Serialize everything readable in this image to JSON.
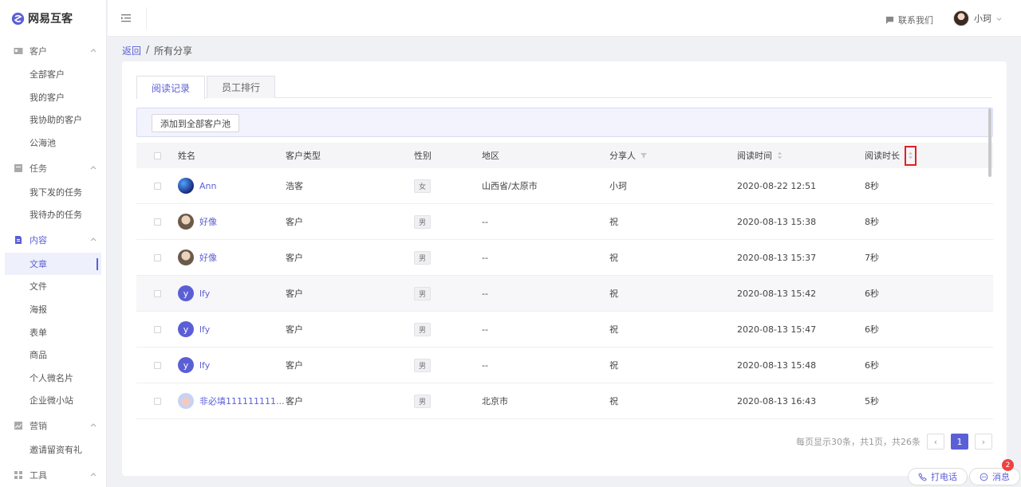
{
  "app": {
    "title": "网易互客"
  },
  "sidebar": {
    "groups": [
      {
        "label": "客户",
        "icon": "id-card-icon",
        "items": [
          "全部客户",
          "我的客户",
          "我协助的客户",
          "公海池"
        ]
      },
      {
        "label": "任务",
        "icon": "task-box-icon",
        "items": [
          "我下发的任务",
          "我待办的任务"
        ]
      },
      {
        "label": "内容",
        "icon": "document-icon",
        "items": [
          "文章",
          "文件",
          "海报",
          "表单",
          "商品",
          "个人微名片",
          "企业微小站"
        ]
      },
      {
        "label": "营销",
        "icon": "chart-icon",
        "items": [
          "邀请留资有礼"
        ]
      },
      {
        "label": "工具",
        "icon": "grid-icon",
        "items": []
      }
    ],
    "active_item": "文章"
  },
  "topbar": {
    "contact": "联系我们",
    "user_name": "小珂"
  },
  "breadcrumb": {
    "back": "返回",
    "current": "所有分享"
  },
  "tabs": [
    "阅读记录",
    "员工排行"
  ],
  "toolbar": {
    "add_button": "添加到全部客户池"
  },
  "table": {
    "columns": [
      "姓名",
      "客户类型",
      "性别",
      "地区",
      "分享人",
      "阅读时间",
      "阅读时长"
    ],
    "rows": [
      {
        "avatar": "Ann",
        "avatar_style": "ann",
        "name": "Ann",
        "type": "浩客",
        "gender": "女",
        "region": "山西省/太原市",
        "sharer": "小珂",
        "time": "2020-08-22 12:51",
        "duration": "8秒"
      },
      {
        "avatar": "",
        "avatar_style": "photo",
        "name": "好像",
        "type": "客户",
        "gender": "男",
        "region": "--",
        "sharer": "祝",
        "time": "2020-08-13 15:38",
        "duration": "8秒"
      },
      {
        "avatar": "",
        "avatar_style": "photo",
        "name": "好像",
        "type": "客户",
        "gender": "男",
        "region": "--",
        "sharer": "祝",
        "time": "2020-08-13 15:37",
        "duration": "7秒"
      },
      {
        "avatar": "y",
        "avatar_style": "y",
        "name": "lfy",
        "type": "客户",
        "gender": "男",
        "region": "--",
        "sharer": "祝",
        "time": "2020-08-13 15:42",
        "duration": "6秒"
      },
      {
        "avatar": "y",
        "avatar_style": "y",
        "name": "lfy",
        "type": "客户",
        "gender": "男",
        "region": "--",
        "sharer": "祝",
        "time": "2020-08-13 15:47",
        "duration": "6秒"
      },
      {
        "avatar": "y",
        "avatar_style": "y",
        "name": "lfy",
        "type": "客户",
        "gender": "男",
        "region": "--",
        "sharer": "祝",
        "time": "2020-08-13 15:48",
        "duration": "6秒"
      },
      {
        "avatar": "",
        "avatar_style": "cartoon",
        "name": "非必填111111111...",
        "type": "客户",
        "gender": "男",
        "region": "北京市",
        "sharer": "祝",
        "time": "2020-08-13 16:43",
        "duration": "5秒"
      }
    ]
  },
  "pagination": {
    "summary": "每页显示30条，共1页，共26条",
    "current_page": "1",
    "prev": "‹",
    "next": "›"
  },
  "float": {
    "call": "打电话",
    "message": "消息",
    "message_badge": "2"
  },
  "colors": {
    "accent": "#5b5fd6",
    "badge": "#f04040",
    "highlight_box": "#e02020"
  }
}
